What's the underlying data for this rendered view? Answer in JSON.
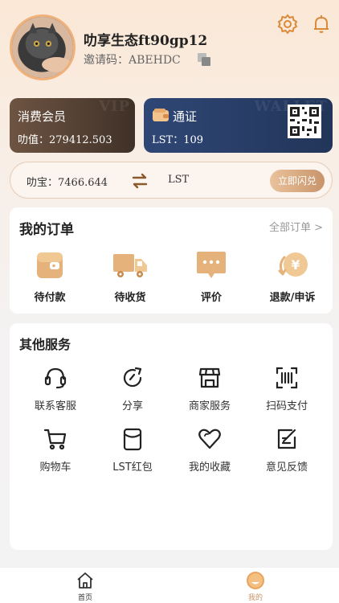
{
  "profile": {
    "username": "叻享生态ft90gp12",
    "invite_label": "邀请码：",
    "invite_code": "ABEHDC"
  },
  "icons": {
    "settings": "gear-icon",
    "notifications": "bell-icon",
    "copy": "copy-icon"
  },
  "cards": {
    "vip": {
      "title": "消费会员",
      "sub_label": "叻值：",
      "value": "279412.503",
      "watermark": "VIP"
    },
    "wallet": {
      "title": "通证",
      "sub_label": "LST：",
      "value": "109",
      "watermark": "WALLET"
    }
  },
  "exchange": {
    "balance_label": "叻宝：",
    "balance_value": "7466.644",
    "target": "LST",
    "button": "立即闪兑"
  },
  "orders": {
    "title": "我的订单",
    "all_label": "全部订单 >",
    "items": [
      {
        "label": "待付款",
        "icon": "wallet-icon"
      },
      {
        "label": "待收货",
        "icon": "truck-icon"
      },
      {
        "label": "评价",
        "icon": "comment-icon"
      },
      {
        "label": "退款/申诉",
        "icon": "refund-icon"
      }
    ]
  },
  "services": {
    "title": "其他服务",
    "items": [
      {
        "label": "联系客服",
        "icon": "headset-icon"
      },
      {
        "label": "分享",
        "icon": "share-icon"
      },
      {
        "label": "商家服务",
        "icon": "store-icon"
      },
      {
        "label": "扫码支付",
        "icon": "scan-icon"
      },
      {
        "label": "购物车",
        "icon": "cart-icon"
      },
      {
        "label": "LST红包",
        "icon": "red-packet-icon"
      },
      {
        "label": "我的收藏",
        "icon": "heart-icon"
      },
      {
        "label": "意见反馈",
        "icon": "feedback-icon"
      }
    ]
  },
  "tabbar": {
    "items": [
      {
        "label": "首页",
        "icon": "home-icon"
      },
      {
        "label": "我的",
        "icon": "profile-icon"
      }
    ]
  },
  "colors": {
    "accent": "#c8946a",
    "vip_card": "#4f3e33",
    "wallet_card": "#2a3f69"
  }
}
